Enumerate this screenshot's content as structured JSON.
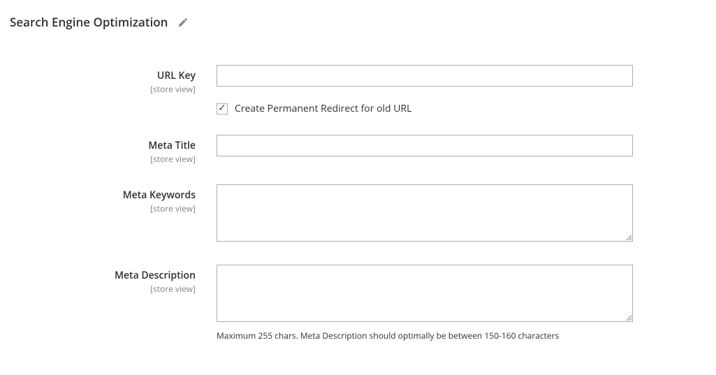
{
  "section": {
    "title": "Search Engine Optimization"
  },
  "fields": {
    "url_key": {
      "label": "URL Key",
      "scope": "[store view]",
      "value": "",
      "checkbox_label": "Create Permanent Redirect for old URL",
      "checkbox_checked": true
    },
    "meta_title": {
      "label": "Meta Title",
      "scope": "[store view]",
      "value": ""
    },
    "meta_keywords": {
      "label": "Meta Keywords",
      "scope": "[store view]",
      "value": ""
    },
    "meta_description": {
      "label": "Meta Description",
      "scope": "[store view]",
      "value": "",
      "note": "Maximum 255 chars. Meta Description should optimally be between 150-160 characters"
    }
  }
}
